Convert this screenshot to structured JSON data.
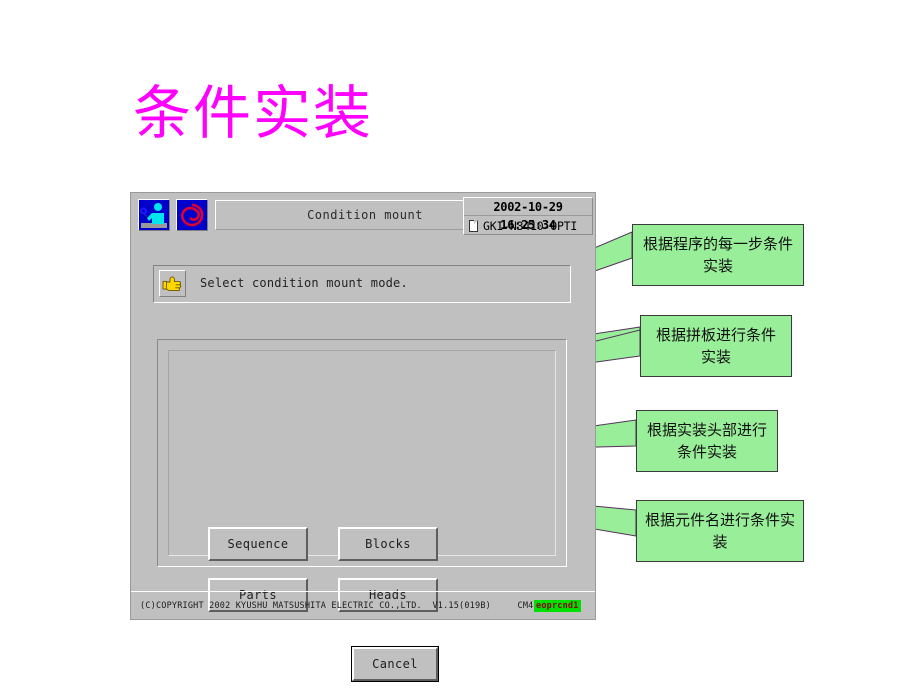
{
  "slide": {
    "title": "条件实装",
    "title_color": "#ff00ff",
    "background": "#ffffff"
  },
  "device_panel": {
    "background": "#c0c0c0",
    "header": {
      "icons": [
        {
          "name": "worker-tool-icon",
          "colors": [
            "#0000cc",
            "#00e5ee"
          ]
        },
        {
          "name": "red-spiral-icon",
          "colors": [
            "#0000cc",
            "#cc0033"
          ]
        }
      ],
      "screen_title": "Condition mount",
      "datetime": "2002-10-29  16:25:34",
      "file_name": "GKI-N3410-OPTI",
      "file_icon": "document-icon"
    },
    "message": {
      "icon": "pointing-hand-icon",
      "icon_color": "#ffd800",
      "text": "Select condition mount mode."
    },
    "buttons": [
      {
        "id": "sequence",
        "label": "Sequence",
        "focused": false
      },
      {
        "id": "blocks",
        "label": "Blocks",
        "focused": false
      },
      {
        "id": "parts",
        "label": "Parts",
        "focused": false
      },
      {
        "id": "heads",
        "label": "Heads",
        "focused": false
      },
      {
        "id": "cancel",
        "label": "Cancel",
        "focused": true
      }
    ],
    "footer": {
      "copyright": "(C)COPYRIGHT 2002 KYUSHU MATSUSHITA ELECTRIC CO.,LTD.  V1.15(019B)     CM402-L",
      "tag": "eoprcnd1",
      "tag_background": "#00e000",
      "tag_color": "#8a0000"
    }
  },
  "annotations": {
    "fill": "#99ee99",
    "border": "#3b3b3b",
    "items": [
      {
        "id": "note-sequence",
        "text": "根据程序的每一步条件实装",
        "target": "Sequence"
      },
      {
        "id": "note-blocks",
        "text": "根据拼板进行条件实装",
        "target": "Blocks"
      },
      {
        "id": "note-heads",
        "text": "根据实装头部进行条件实装",
        "target": "Heads"
      },
      {
        "id": "note-parts",
        "text": "根据元件名进行条件实装",
        "target": "Parts"
      }
    ]
  }
}
